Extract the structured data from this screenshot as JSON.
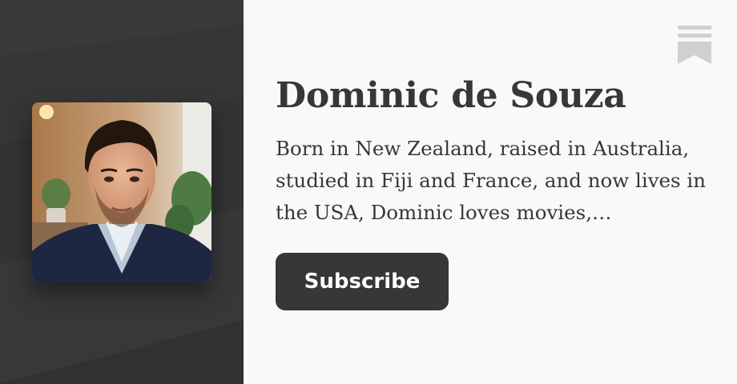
{
  "profile": {
    "name": "Dominic de Souza",
    "description": "Born in New Zealand, raised in Australia, studied in Fiji and France, and now lives in the USA, Dominic loves movies,…",
    "avatar_icon": "person-portrait"
  },
  "actions": {
    "subscribe_label": "Subscribe"
  },
  "icons": {
    "brand": "bookmark-icon"
  },
  "colors": {
    "left_panel": "#363638",
    "page_background": "#f9f9f9",
    "text": "#363737",
    "button_background": "#363737",
    "button_text": "#ffffff",
    "logo": "#d0d0d0"
  }
}
